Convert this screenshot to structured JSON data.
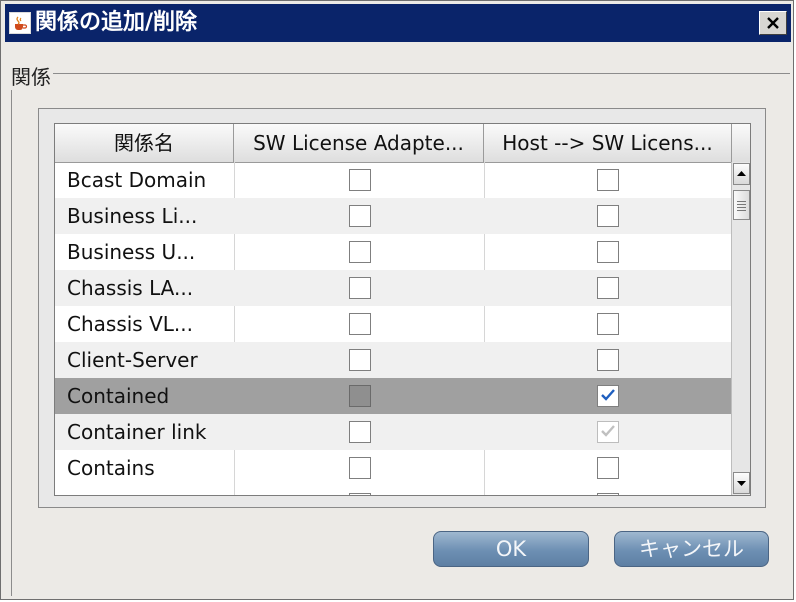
{
  "dialog": {
    "title": "関係の追加/削除",
    "icon": "java-cup-icon",
    "close_icon": "close-icon"
  },
  "group": {
    "label": "関係"
  },
  "table": {
    "columns": [
      "関係名",
      "SW License Adapte...",
      "Host --> SW Licens..."
    ],
    "rows": [
      {
        "name": "Bcast Domain",
        "col1": "unchecked",
        "col2": "unchecked"
      },
      {
        "name": "Business Li...",
        "col1": "unchecked",
        "col2": "unchecked"
      },
      {
        "name": "Business U...",
        "col1": "unchecked",
        "col2": "unchecked"
      },
      {
        "name": "Chassis LA...",
        "col1": "unchecked",
        "col2": "unchecked"
      },
      {
        "name": "Chassis VL...",
        "col1": "unchecked",
        "col2": "unchecked"
      },
      {
        "name": "Client-Server",
        "col1": "unchecked",
        "col2": "unchecked"
      },
      {
        "name": "Contained",
        "col1": "unchecked",
        "col2": "checked",
        "selected": true
      },
      {
        "name": "Container link",
        "col1": "unchecked",
        "col2": "checked-disabled"
      },
      {
        "name": "Contains",
        "col1": "unchecked",
        "col2": "unchecked"
      }
    ],
    "selected_row_color": "#a0a0a0",
    "check_color": "#1f5fbf"
  },
  "buttons": {
    "ok": "OK",
    "cancel": "キャンセル"
  },
  "colors": {
    "titlebar": "#0a246a",
    "button": "#6d8fb3"
  }
}
